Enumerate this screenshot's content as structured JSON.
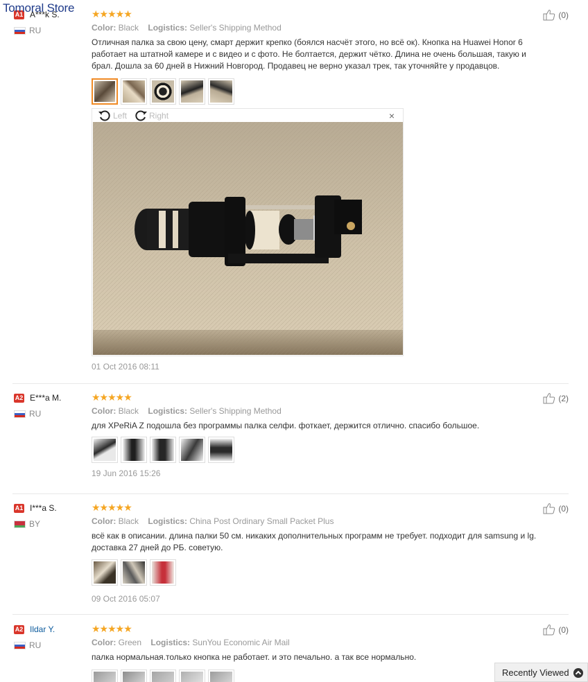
{
  "watermark": "Tomoral Store",
  "labels": {
    "color": "Color:",
    "logistics": "Logistics:"
  },
  "viewer": {
    "left": "Left",
    "right": "Right",
    "close": "×"
  },
  "recently_viewed": "Recently Viewed",
  "reviews": [
    {
      "level": "A1",
      "name": "A***k S.",
      "country": "RU",
      "stars": "★★★★★",
      "color": "Black",
      "logistics": "Seller's Shipping Method",
      "text": "Отличная палка за свою цену, смарт держит крепко (боялся насчёт этого, но всё ок). Кнопка на Huawei Honor 6 работает на штатной камере и с видео и с фото. Не болтается, держит чётко. Длина не очень большая, такую и брал. Дошла за 60 дней в Нижний Новгород. Продавец не верно указал трек, так уточняйте у продавцов.",
      "date": "01 Oct 2016 08:11",
      "likes": "(0)",
      "thumb_count": 5
    },
    {
      "level": "A2",
      "name": "E***a M.",
      "country": "RU",
      "stars": "★★★★★",
      "color": "Black",
      "logistics": "Seller's Shipping Method",
      "text": "для XPeRiA Z подошла без программы палка селфи. фоткает, держится отлично. спасибо большое.",
      "date": "19 Jun 2016 15:26",
      "likes": "(2)",
      "thumb_count": 5
    },
    {
      "level": "A1",
      "name": "I***a S.",
      "country": "BY",
      "stars": "★★★★★",
      "color": "Black",
      "logistics": "China Post Ordinary Small Packet Plus",
      "text": "всё как в описании. длина палки 50 см. никаких дополнительных программ не требует. подходит для samsung и lg. доставка 27 дней до РБ. советую.",
      "date": "09 Oct 2016 05:07",
      "likes": "(0)",
      "thumb_count": 3
    },
    {
      "level": "A2",
      "name": "Ildar Y.",
      "country": "RU",
      "stars": "★★★★★",
      "color": "Green",
      "logistics": "SunYou Economic Air Mail",
      "text": "палка нормальная.только кнопка не работает. и это печально. а так все нормально.",
      "date": "",
      "likes": "(0)",
      "thumb_count": 5
    }
  ]
}
